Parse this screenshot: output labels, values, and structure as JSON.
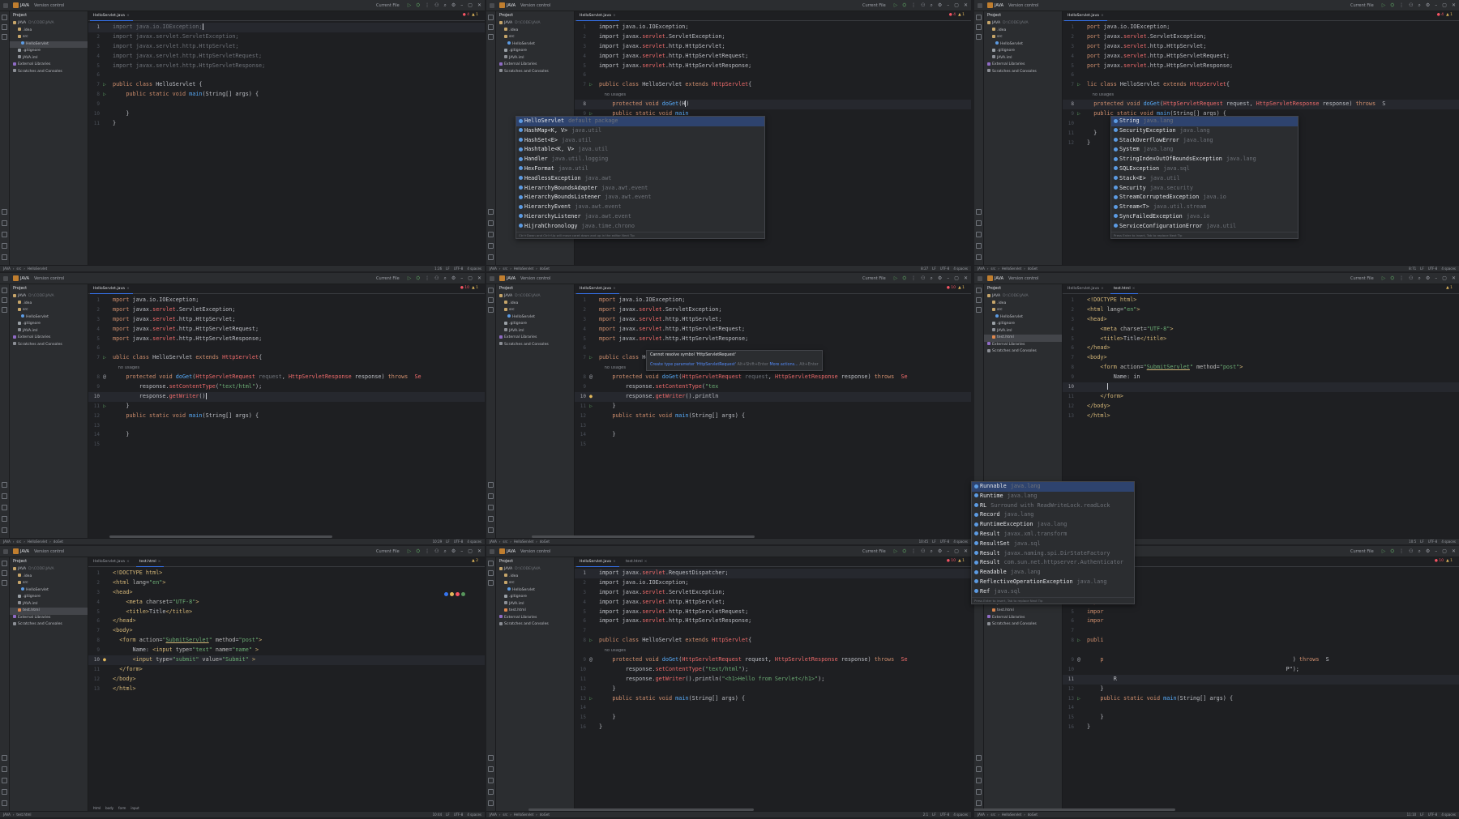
{
  "colors": {
    "accent": "#3574f0",
    "keyword": "#cf8e6d",
    "string": "#6aab73",
    "error": "#f75464",
    "method": "#56a8f5"
  },
  "common": {
    "project_name": "JAVA",
    "version_control": "Version control",
    "current_file": "Current File",
    "project_label": "Project",
    "tree": [
      {
        "label": "JAVA",
        "muted": "D:\\CODE\\JAVA",
        "type": "folder"
      },
      {
        "label": ".idea",
        "type": "folder"
      },
      {
        "label": "src",
        "type": "folder"
      },
      {
        "label": "HelloServlet",
        "type": "java"
      },
      {
        "label": ".gitignore",
        "type": "git"
      },
      {
        "label": "JAVA.iml",
        "type": "file"
      },
      {
        "label": "External Libraries",
        "type": "lib"
      },
      {
        "label": "Scratches and Consoles",
        "type": "file"
      }
    ],
    "tree_with_html": [
      {
        "label": "JAVA",
        "muted": "D:\\CODE\\JAVA",
        "type": "folder"
      },
      {
        "label": ".idea",
        "type": "folder"
      },
      {
        "label": "src",
        "type": "folder"
      },
      {
        "label": "HelloServlet",
        "type": "java"
      },
      {
        "label": ".gitignore",
        "type": "git"
      },
      {
        "label": "JAVA.iml",
        "type": "file"
      },
      {
        "label": "test.html",
        "type": "html"
      },
      {
        "label": "External Libraries",
        "type": "lib"
      },
      {
        "label": "Scratches and Consoles",
        "type": "file"
      }
    ],
    "tab_java": "HelloServlet.java",
    "tab_html": "test.html",
    "status_java": [
      "JAVA",
      "src",
      "HelloServlet"
    ],
    "status_html": [
      "JAVA",
      "test.html"
    ],
    "status_right": [
      "LF",
      "UTF-8",
      "4 spaces"
    ]
  },
  "panels": [
    {
      "id": "p1",
      "tabs": [
        "java"
      ],
      "active": 0,
      "tree": "tree",
      "current_line": 1,
      "inspect": {
        "errors": "4",
        "warnings": "1"
      },
      "status_extra": "",
      "position": "1:26",
      "lines": [
        "<span class='dim'>import java.io.IOException;</span><span class='caret'></span>",
        "<span class='dim'>import javax.servlet.ServletException;</span>",
        "<span class='dim'>import javax.servlet.http.HttpServlet;</span>",
        "<span class='dim'>import javax.servlet.http.HttpServletRequest;</span>",
        "<span class='dim'>import javax.servlet.http.HttpServletResponse;</span>",
        "",
        "<span class='k'>public class</span> HelloServlet {",
        "    <span class='k'>public static void</span> <span class='f'>main</span>(String[] args) {",
        "",
        "    }",
        "}"
      ],
      "gutter": {
        "7": "▷",
        "8": "▷"
      }
    },
    {
      "id": "p2",
      "tabs": [
        "java"
      ],
      "active": 0,
      "tree": "tree",
      "current_line": 8,
      "inspect": {
        "errors": "4",
        "warnings": "1"
      },
      "status_extra": "doGet",
      "position": "8:27",
      "lines": [
        "import java.io.IOException;",
        "import javax.<span class='r'>servlet</span>.ServletException;",
        "import javax.<span class='r'>servlet</span>.http.HttpServlet;",
        "import javax.<span class='r'>servlet</span>.http.HttpServletRequest;",
        "import javax.<span class='r'>servlet</span>.http.HttpServletResponse;",
        "",
        "<span class='k'>public class</span> HelloServlet <span class='k'>extends</span> <span class='r'>HttpServlet</span>{",
        "<span class='hint'>    no usages</span>",
        "    <span class='k'>protected void</span> <span class='f'>doGet</span>(H<span class='caret'></span>)",
        "    <span class='k'>public static void</span> <span class='f'>main</span>",
        "",
        "    }",
        "}"
      ],
      "line_numbers": [
        "1",
        "2",
        "3",
        "4",
        "5",
        "6",
        "7",
        "",
        "8",
        "9",
        "10",
        "11",
        "12"
      ],
      "gutter": {
        "7": "▷",
        "10": "▷"
      },
      "popup": {
        "items": [
          [
            "HelloServlet",
            "default package"
          ],
          [
            "HashMap<K, V>",
            "java.util"
          ],
          [
            "HashSet<E>",
            "java.util"
          ],
          [
            "Hashtable<K, V>",
            "java.util"
          ],
          [
            "Handler",
            "java.util.logging"
          ],
          [
            "HexFormat",
            "java.util"
          ],
          [
            "HeadlessException",
            "java.awt"
          ],
          [
            "HierarchyBoundsAdapter",
            "java.awt.event"
          ],
          [
            "HierarchyBoundsListener",
            "java.awt.event"
          ],
          [
            "HierarchyEvent",
            "java.awt.event"
          ],
          [
            "HierarchyListener",
            "java.awt.event"
          ],
          [
            "HijrahChronology",
            "java.time.chrono"
          ]
        ],
        "footer": "Ctrl+Down and Ctrl+Up will move caret down and up in the editor  Next Tip"
      }
    },
    {
      "id": "p3",
      "tabs": [
        "java"
      ],
      "active": 0,
      "tree": "tree",
      "current_line": 8,
      "inspect": {
        "errors": "4",
        "warnings": "1"
      },
      "status_extra": "doGet",
      "position": "8:71",
      "lines": [
        "<span class='k'>port</span> java.io.IOException;",
        "<span class='k'>port</span> javax.<span class='r'>servlet</span>.ServletException;",
        "<span class='k'>port</span> javax.<span class='r'>servlet</span>.http.HttpServlet;",
        "<span class='k'>port</span> javax.<span class='r'>servlet</span>.http.HttpServletRequest;",
        "<span class='k'>port</span> javax.<span class='r'>servlet</span>.http.HttpServletResponse;",
        "",
        "<span class='k'>lic class</span> HelloServlet <span class='k'>extends</span> <span class='r'>HttpServlet</span>{",
        "<span class='hint'>    no usages</span>",
        "  <span class='k'>protected void</span> <span class='f'>doGet</span>(<span class='r'>HttpServletRequest</span> request, <span class='r'>HttpServletResponse</span> response) <span class='k'>throws</span>  S",
        "  <span class='k'>public static void</span> <span class='f'>main</span>(String[] args) {",
        "",
        "  }",
        "}"
      ],
      "line_numbers": [
        "1",
        "2",
        "3",
        "4",
        "5",
        "6",
        "7",
        "",
        "8",
        "9",
        "10",
        "11",
        "12"
      ],
      "gutter": {
        "7": "▷",
        "10": "▷"
      },
      "popup": {
        "items": [
          [
            "String",
            "java.lang"
          ],
          [
            "SecurityException",
            "java.lang"
          ],
          [
            "StackOverflowError",
            "java.lang"
          ],
          [
            "System",
            "java.lang"
          ],
          [
            "StringIndexOutOfBoundsException",
            "java.lang"
          ],
          [
            "SQLException",
            "java.sql"
          ],
          [
            "Stack<E>",
            "java.util"
          ],
          [
            "Security",
            "java.security"
          ],
          [
            "StreamCorruptedException",
            "java.io"
          ],
          [
            "Stream<T>",
            "java.util.stream"
          ],
          [
            "SyncFailedException",
            "java.io"
          ],
          [
            "ServiceConfigurationError",
            "java.util"
          ]
        ],
        "footer": "Press Enter to insert, Tab to replace  Next Tip"
      }
    },
    {
      "id": "p4",
      "tabs": [
        "java"
      ],
      "active": 0,
      "tree": "tree",
      "current_line": 10,
      "inspect": {
        "errors": "10",
        "warnings": "1"
      },
      "status_extra": "doGet",
      "position": "10:29",
      "lines": [
        "<span class='k'>mport</span> java.io.IOException;",
        "<span class='k'>mport</span> javax.<span class='r'>servlet</span>.ServletException;",
        "<span class='k'>mport</span> javax.<span class='r'>servlet</span>.http.HttpServlet;",
        "<span class='k'>mport</span> javax.<span class='r'>servlet</span>.http.HttpServletRequest;",
        "<span class='k'>mport</span> javax.<span class='r'>servlet</span>.http.HttpServletResponse;",
        "",
        "<span class='k'>ublic class</span> HelloServlet <span class='k'>extends</span> <span class='r'>HttpServlet</span>{",
        "<span class='hint'>    no usages</span>",
        "    <span class='k'>protected void</span> <span class='f'>doGet</span>(<span class='r'>HttpServletRequest</span> <span class='dim'>request</span>, <span class='r'>HttpServletResponse</span> response) <span class='k'>throws</span>  <span class='r'>Se</span>",
        "        response.<span class='r'>setContentType</span>(<span class='s'>\"text/html\"</span>);",
        "        response.<span class='r'>getWriter</span>()<span class='caret'></span>",
        "    }",
        "    <span class='k'>public static void</span> <span class='f'>main</span>(String[] args) {",
        "",
        "    }",
        ""
      ],
      "line_numbers": [
        "1",
        "2",
        "3",
        "4",
        "5",
        "6",
        "7",
        "",
        "8",
        "9",
        "10",
        "11",
        "12",
        "13",
        "14",
        "15"
      ],
      "gutter": {
        "7": "▷",
        "9": "@",
        "12": "▷"
      }
    },
    {
      "id": "p5",
      "tabs": [
        "java"
      ],
      "active": 0,
      "tree": "tree",
      "current_line": 10,
      "inspect": {
        "errors": "10",
        "warnings": "1"
      },
      "status_extra": "doGet",
      "position": "10:45",
      "lines": [
        "<span class='k'>mport</span> java.io.IOException;",
        "<span class='k'>mport</span> javax.<span class='r'>servlet</span>.ServletException;",
        "<span class='k'>mport</span> javax.<span class='r'>servlet</span>.http.HttpServlet;",
        "<span class='k'>mport</span> javax.<span class='r'>servlet</span>.http.HttpServletRequest;",
        "<span class='k'>mport</span> javax.<span class='r'>servlet</span>.http.HttpServletResponse;",
        "",
        "<span class='k'>public class</span> HelloServlet <span class='k'>extends</span> <span class='r'>HttpServlet</span>{",
        "<span class='hint'>    no usages</span>",
        "    <span class='k'>protected void</span> <span class='f'>doGet</span>(<span class='r'>HttpServletRequest</span> <span class='dim'>request</span>, <span class='r'>HttpServletResponse</span> response) <span class='k'>throws</span>  <span class='r'>Se</span>",
        "        response.<span class='r'>setContentType</span>(<span class='s'>\"tex</span>",
        "        response.<span class='r'>getWriter</span>().println",
        "    }",
        "    <span class='k'>public static void</span> <span class='f'>main</span>(String[] args) {",
        "",
        "    }",
        ""
      ],
      "line_numbers": [
        "1",
        "2",
        "3",
        "4",
        "5",
        "6",
        "7",
        "",
        "8",
        "9",
        "10",
        "11",
        "12",
        "13",
        "14",
        "15"
      ],
      "gutter": {
        "7": "▷",
        "9": "@",
        "11": "●",
        "12": "▷"
      },
      "tooltip": {
        "message": "Cannot resolve symbol 'HttpServletRequest'",
        "action": "Create type parameter 'HttpServletRequest'",
        "action_key": "Alt+Shift+Enter",
        "more": "More actions...",
        "more_key": "Alt+Enter"
      }
    },
    {
      "id": "p6",
      "tabs": [
        "java",
        "html"
      ],
      "active": 1,
      "tree": "tree_html",
      "current_line": 10,
      "inspect": {
        "errors": "",
        "warnings": "1"
      },
      "status_extra": "",
      "position": "10:5",
      "lines": [
        "<span class='tag'>&lt;!DOCTYPE html&gt;</span>",
        "<span class='tag'>&lt;html</span> <span class='attr'>lang</span>=<span class='s'>\"en\"</span><span class='tag'>&gt;</span>",
        "<span class='tag'>&lt;head&gt;</span>",
        "    <span class='tag'>&lt;meta</span> <span class='attr'>charset</span>=<span class='s'>\"UTF-8\"</span><span class='tag'>&gt;</span>",
        "    <span class='tag'>&lt;title&gt;</span>Title<span class='tag'>&lt;/title&gt;</span>",
        "<span class='tag'>&lt;/head&gt;</span>",
        "<span class='tag'>&lt;body&gt;</span>",
        "    <span class='tag'>&lt;form</span> <span class='attr'>action</span>=<span class='s'>\"<span class='ul'>SubmitServlet</span>\"</span> <span class='attr'>method</span>=<span class='s'>\"post\"</span><span class='tag'>&gt;</span>",
        "        Name: in",
        "      <span class='caret'></span>",
        "    <span class='tag'>&lt;/form&gt;</span>",
        "<span class='tag'>&lt;/body&gt;</span>",
        "<span class='tag'>&lt;/html&gt;</span>"
      ],
      "gutter": {},
      "crumbs": [
        "html",
        "body",
        "form"
      ]
    },
    {
      "id": "p7",
      "tabs": [
        "java",
        "html"
      ],
      "active": 1,
      "tree": "tree_html",
      "current_line": 10,
      "inspect": {
        "errors": "",
        "warnings": "2"
      },
      "status_extra": "",
      "position": "10:44",
      "lines": [
        "<span class='tag'>&lt;!DOCTYPE html&gt;</span>",
        "<span class='tag'>&lt;html</span> <span class='attr'>lang</span>=<span class='s'>\"en\"</span><span class='tag'>&gt;</span>",
        "<span class='tag'>&lt;head&gt;</span>",
        "    <span class='tag'>&lt;meta</span> <span class='attr'>charset</span>=<span class='s'>\"UTF-8\"</span><span class='tag'>&gt;</span>",
        "    <span class='tag'>&lt;title&gt;</span>Title<span class='tag'>&lt;/title&gt;</span>",
        "<span class='tag'>&lt;/head&gt;</span>",
        "<span class='tag'>&lt;body&gt;</span>",
        "  <span class='tag'>&lt;form</span> <span class='attr'>action</span>=<span class='s'>\"<span class='ul'>SubmitServlet</span>\"</span> <span class='attr'>method</span>=<span class='s'>\"post\"</span><span class='tag'>&gt;</span>",
        "      Name: <span class='tag'>&lt;input</span> <span class='attr'>type</span>=<span class='s'>\"text\"</span> <span class='attr'>name</span>=<span class='s'>\"name\"</span> <span class='tag'>&gt;</span>",
        "      <span class='tag'>&lt;input</span> <span class='attr'>type</span>=<span class='s'>\"submit\"</span> <span class='attr'>value</span>=<span class='s'>\"Submit\"</span> <span class='tag'>&gt;</span>",
        "  <span class='tag'>&lt;/form&gt;</span>",
        "<span class='tag'>&lt;/body&gt;</span>",
        "<span class='tag'>&lt;/html&gt;</span>"
      ],
      "gutter": {
        "10": "●"
      },
      "crumbs": [
        "html",
        "body",
        "form",
        "input"
      ],
      "float_icons": true
    },
    {
      "id": "p8",
      "tabs": [
        "java",
        "html"
      ],
      "active": 0,
      "tree": "tree_html",
      "current_line": 1,
      "inspect": {
        "errors": "10",
        "warnings": "1"
      },
      "status_extra": "doGet",
      "position": "2:1",
      "lines": [
        "import javax.<span class='r'>servlet</span>.RequestDispatcher;",
        "import java.io.IOException;",
        "import javax.<span class='r'>servlet</span>.ServletException;",
        "import javax.<span class='r'>servlet</span>.http.HttpServlet;",
        "import javax.<span class='r'>servlet</span>.http.HttpServletRequest;",
        "import javax.<span class='r'>servlet</span>.http.HttpServletResponse;",
        "",
        "<span class='k'>public class</span> HelloServlet <span class='k'>extends</span> <span class='r'>HttpServlet</span>{",
        "<span class='hint'>    no usages</span>",
        "    <span class='k'>protected void</span> <span class='f'>doGet</span>(<span class='r'>HttpServletRequest</span> request, <span class='r'>HttpServletResponse</span> response) <span class='k'>throws</span>  <span class='r'>Se</span>",
        "        response.<span class='r'>setContentType</span>(<span class='s'>\"text/html\"</span>);",
        "        response.<span class='r'>getWriter</span>().println(<span class='s'>\"&lt;h1&gt;Hello from Servlet&lt;/h1&gt;\"</span>);",
        "    }",
        "    <span class='k'>public static void</span> <span class='f'>main</span>(String[] args) {",
        "",
        "    }",
        "}"
      ],
      "line_numbers": [
        "1",
        "2",
        "3",
        "4",
        "5",
        "6",
        "7",
        "8",
        "",
        "9",
        "10",
        "11",
        "12",
        "13",
        "14",
        "15",
        "16"
      ],
      "gutter": {
        "8": "▷",
        "10": "@",
        "14": "▷"
      }
    },
    {
      "id": "p9",
      "tabs": [
        "java"
      ],
      "active": 0,
      "tree": "tree_html",
      "current_line": 11,
      "inspect": {
        "errors": "10",
        "warnings": "1"
      },
      "status_extra": "doGet",
      "position": "11:10",
      "lines": [
        "",
        "<span class='k'>impor</span>",
        "<span class='k'>impor</span>",
        "<span class='k'>impor</span>",
        "<span class='k'>impor</span>",
        "<span class='k'>impor</span>",
        "",
        "<span class='k'>publi</span>",
        "",
        "    <span class='k'>p</span>                                                         ) <span class='k'>throws</span>  S",
        "                                                            P\");",
        "        R",
        "    }",
        "    <span class='k'>public static void</span> <span class='f'>main</span>(String[] args) {",
        "",
        "    }",
        "}"
      ],
      "line_numbers": [
        "1",
        "2",
        "3",
        "4",
        "5",
        "6",
        "7",
        "8",
        "",
        "9",
        "10",
        "11",
        "12",
        "13",
        "14",
        "15",
        "16"
      ],
      "gutter": {
        "8": "▷",
        "10": "@",
        "14": "▷"
      },
      "popup": {
        "items": [
          [
            "Runnable",
            "java.lang"
          ],
          [
            "Runtime",
            "java.lang"
          ],
          [
            "RL",
            "Surround with ReadWriteLock.readLock"
          ],
          [
            "Record",
            "java.lang"
          ],
          [
            "RuntimeException",
            "java.lang"
          ],
          [
            "Result",
            "javax.xml.transform"
          ],
          [
            "ResultSet",
            "java.sql"
          ],
          [
            "Result",
            "javax.naming.spi.DirStateFactory"
          ],
          [
            "Result",
            "com.sun.net.httpserver.Authenticator"
          ],
          [
            "Readable",
            "java.lang"
          ],
          [
            "ReflectiveOperationException",
            "java.lang"
          ],
          [
            "Ref",
            "java.sql"
          ]
        ],
        "footer": "Press Enter to insert, Tab to replace  Next Tip"
      }
    }
  ]
}
